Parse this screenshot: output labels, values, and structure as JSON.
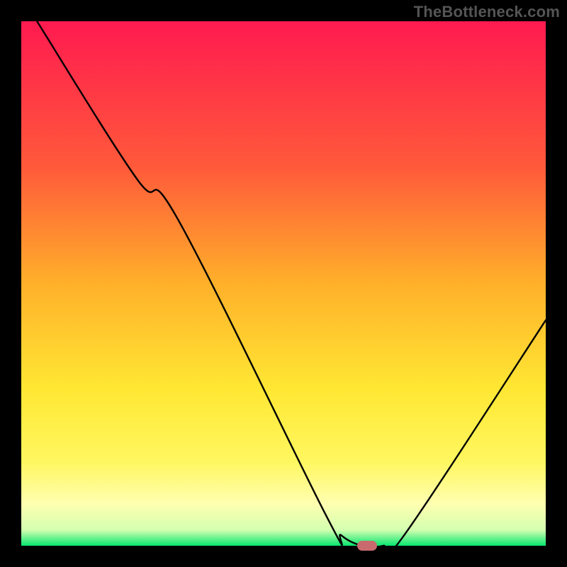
{
  "watermark": "TheBottleneck.com",
  "chart_data": {
    "type": "line",
    "title": "",
    "xlabel": "",
    "ylabel": "",
    "xlim": [
      0,
      100
    ],
    "ylim": [
      0,
      100
    ],
    "grid": false,
    "legend": false,
    "gradient_stops": [
      {
        "offset": 0,
        "color": "#ff1a50"
      },
      {
        "offset": 28,
        "color": "#ff5a3a"
      },
      {
        "offset": 50,
        "color": "#ffb02a"
      },
      {
        "offset": 70,
        "color": "#ffe733"
      },
      {
        "offset": 84,
        "color": "#fff760"
      },
      {
        "offset": 92,
        "color": "#ffffb0"
      },
      {
        "offset": 97,
        "color": "#d3ffb0"
      },
      {
        "offset": 100,
        "color": "#06e66f"
      }
    ],
    "x": [
      0,
      3,
      22,
      30,
      58,
      61,
      65,
      69,
      73,
      100
    ],
    "values": [
      105,
      100,
      70,
      62,
      6,
      2,
      0,
      0,
      2,
      43
    ],
    "marker": {
      "x": 66,
      "y": 0,
      "color": "#c96a6f"
    }
  }
}
